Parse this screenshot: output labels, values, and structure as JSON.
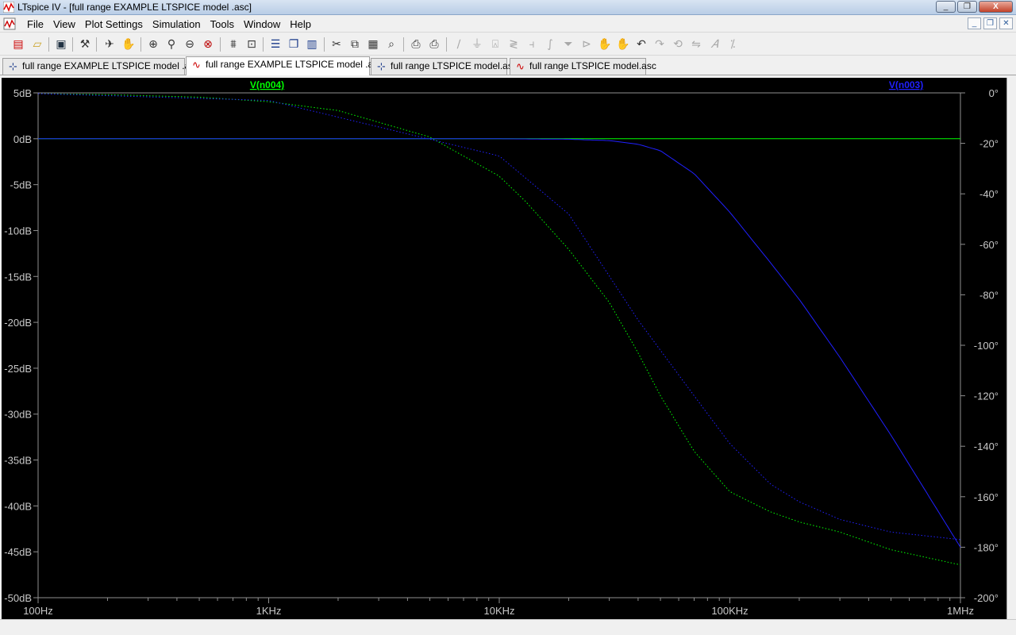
{
  "window": {
    "title": "LTspice IV - [full range EXAMPLE LTSPICE model .asc]",
    "minimize_label": "_",
    "restore_label": "❐",
    "close_label": "X"
  },
  "menu": {
    "items": [
      "File",
      "View",
      "Plot Settings",
      "Simulation",
      "Tools",
      "Window",
      "Help"
    ],
    "mdi": {
      "minimize_label": "_",
      "restore_label": "❐",
      "close_label": "✕"
    }
  },
  "toolbar": {
    "icons": [
      "new-schematic-icon",
      "open-icon",
      "save-icon",
      "control-panel-icon",
      "run-icon",
      "halt-icon",
      "zoom-in-icon",
      "zoom-rect-icon",
      "zoom-out-icon",
      "zoom-cancel-icon",
      "autorange-icon",
      "zoom-extents-icon",
      "tile-horizontal-icon",
      "cascade-icon",
      "tile-vertical-icon",
      "cut-icon",
      "copy-icon",
      "paste-icon",
      "find-icon",
      "print-setup-icon",
      "print-icon",
      "wire-icon",
      "ground-icon",
      "label-net-icon",
      "resistor-icon",
      "capacitor-icon",
      "inductor-icon",
      "diode-icon",
      "component-icon",
      "move-icon",
      "drag-icon",
      "undo-icon",
      "redo-icon",
      "rotate-icon",
      "mirror-icon",
      "text-icon",
      "spice-directive-icon"
    ]
  },
  "tabs": [
    {
      "label": "full range EXAMPLE LTSPICE model .asc",
      "icon": "schematic-icon",
      "active": false
    },
    {
      "label": "full range EXAMPLE LTSPICE model .asc",
      "icon": "waveform-icon",
      "active": true
    },
    {
      "label": "full range LTSPICE model.asc",
      "icon": "schematic-icon",
      "active": false
    },
    {
      "label": "full range LTSPICE model.asc",
      "icon": "waveform-icon",
      "active": false
    }
  ],
  "chart_data": {
    "type": "line",
    "x_scale": "log",
    "xlim": [
      100,
      1000000
    ],
    "x_ticks": [
      {
        "value": 100,
        "label": "100Hz"
      },
      {
        "value": 1000,
        "label": "1KHz"
      },
      {
        "value": 10000,
        "label": "10KHz"
      },
      {
        "value": 100000,
        "label": "100KHz"
      },
      {
        "value": 1000000,
        "label": "1MHz"
      }
    ],
    "ylim": [
      -50,
      5
    ],
    "y_ticks": [
      "5dB",
      "0dB",
      "-5dB",
      "-10dB",
      "-15dB",
      "-20dB",
      "-25dB",
      "-30dB",
      "-35dB",
      "-40dB",
      "-45dB",
      "-50dB"
    ],
    "y2lim": [
      -200,
      0
    ],
    "y2_ticks": [
      "0°",
      "-20°",
      "-40°",
      "-60°",
      "-80°",
      "-100°",
      "-120°",
      "-140°",
      "-160°",
      "-180°",
      "-200°"
    ],
    "grid": false,
    "series": [
      {
        "name": "V(n004)",
        "color": "#00ff00",
        "magnitude_db": {
          "x": [
            100,
            1000000
          ],
          "y": [
            0,
            0
          ]
        },
        "phase_deg": {
          "x": [
            100,
            200,
            500,
            1000,
            2000,
            5000,
            10000,
            13000,
            20000,
            30000,
            40000,
            50000,
            70000,
            100000,
            150000,
            200000,
            300000,
            500000,
            1000000
          ],
          "y": [
            -0.3,
            -0.7,
            -1.7,
            -3.5,
            -7,
            -17.5,
            -33,
            -43,
            -62,
            -83,
            -103,
            -120,
            -142,
            -158,
            -166,
            -170,
            -174,
            -181,
            -187
          ]
        }
      },
      {
        "name": "V(n003)",
        "color": "#2020ff",
        "magnitude_db": {
          "x": [
            100,
            10000,
            20000,
            30000,
            40000,
            50000,
            70000,
            100000,
            150000,
            200000,
            300000,
            500000,
            1000000
          ],
          "y": [
            0,
            0,
            -0.05,
            -0.2,
            -0.6,
            -1.3,
            -3.8,
            -8,
            -13.5,
            -17.5,
            -23.8,
            -32.3,
            -44.5
          ]
        },
        "phase_deg": {
          "x": [
            100,
            1000,
            10000,
            20000,
            40000,
            70000,
            100000,
            150000,
            200000,
            300000,
            500000,
            1000000
          ],
          "y": [
            -0.3,
            -3,
            -25,
            -48,
            -90,
            -120,
            -139,
            -155,
            -162,
            -169,
            -174,
            -177
          ]
        }
      }
    ]
  }
}
